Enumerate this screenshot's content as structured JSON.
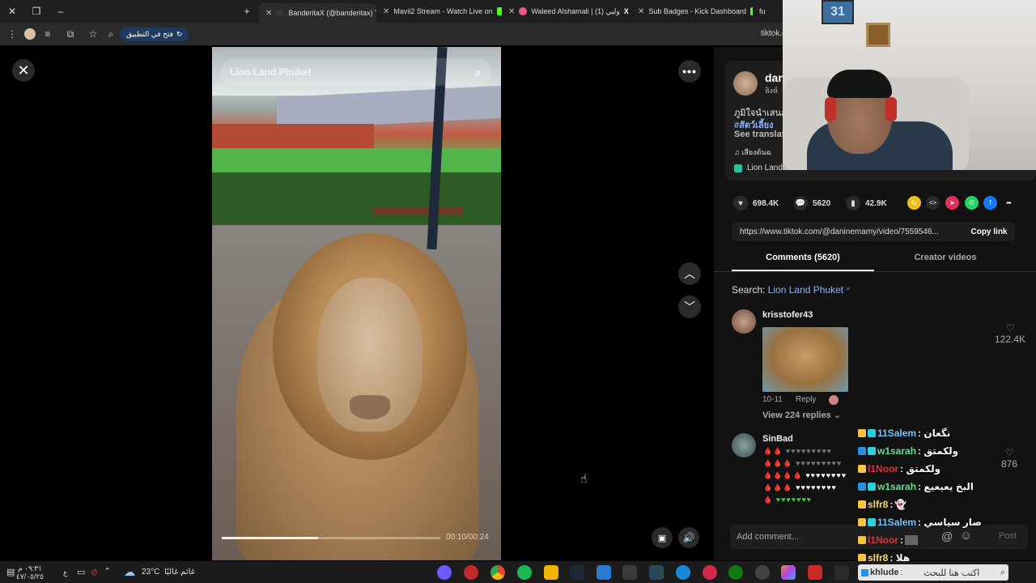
{
  "browser": {
    "tabs": [
      {
        "label": "BanderitaX (@banderitax) Ti",
        "active": true
      },
      {
        "label": "Mavii2 Stream - Watch Live on"
      },
      {
        "label": "Waleed Alshamali | وليي (1)"
      },
      {
        "label": "Sub Badges - Kick Dashboard"
      },
      {
        "label": "fu"
      }
    ],
    "open_app_label": "فتح في التطبيق",
    "url": "tiktok.c"
  },
  "video": {
    "search_text": "Lion Land Phuket",
    "time": "00:10/00:24",
    "progress": 0.44
  },
  "author": {
    "name": "dan",
    "sub": "ลิงห์",
    "desc": "ภูมิใจนำเสนอ",
    "hashtag": "#สัตว์เลี้ยง",
    "see_translation": "See translat",
    "sound": "เสียงต้นฉ",
    "location": "Lion Land"
  },
  "stats": {
    "likes": "698.4K",
    "comments": "5620",
    "saves": "42.9K"
  },
  "link": {
    "url": "https://www.tiktok.com/@daninemamy/video/7559546...",
    "copy_label": "Copy link"
  },
  "tabs": {
    "comments": "Comments (5620)",
    "creator": "Creator videos"
  },
  "search": {
    "prefix": "Search:",
    "keyword": "Lion Land Phuket"
  },
  "comments": [
    {
      "user": "krisstofer43",
      "date": "10-11",
      "reply": "Reply",
      "view_replies": "View 224 replies",
      "likes": "122.4K"
    },
    {
      "user": "SinBad",
      "likes": "876"
    }
  ],
  "add_comment": {
    "placeholder": "Add comment...",
    "post": "Post"
  },
  "webcam": {
    "frame_number": "31"
  },
  "chat": [
    {
      "user": "11Salem",
      "msg": ": نگعان",
      "color": "#6ec6ff"
    },
    {
      "user": "w1sarah",
      "msg": ": ولكمتق",
      "color": "#5fe08a"
    },
    {
      "user": "l1Noor",
      "msg": ": ولكمتق",
      "color": "#e0303a"
    },
    {
      "user": "w1sarah",
      "msg": ": البخ يعيعيع",
      "color": "#5fe08a"
    },
    {
      "user": "slfr8",
      "msg": ":",
      "color": "#f5d76e"
    },
    {
      "user": "11Salem",
      "msg": ": صار سياسي",
      "color": "#6ec6ff"
    },
    {
      "user": "l1Noor",
      "msg": ":",
      "color": "#e0303a"
    },
    {
      "user": "slfr8",
      "msg": ": هلا",
      "color": "#f5d76e"
    },
    {
      "user": "khlude",
      "msg": ":",
      "color": "#6ec6ff"
    }
  ],
  "chat_input_placeholder": "اكتب هنا للبحث",
  "taskbar": {
    "time": "٠٩:٣١ م",
    "date": "٤٧/٠٥/٢٥",
    "weather": "23°C",
    "weather_label": "غائم غالبًا",
    "lang": "ع"
  }
}
